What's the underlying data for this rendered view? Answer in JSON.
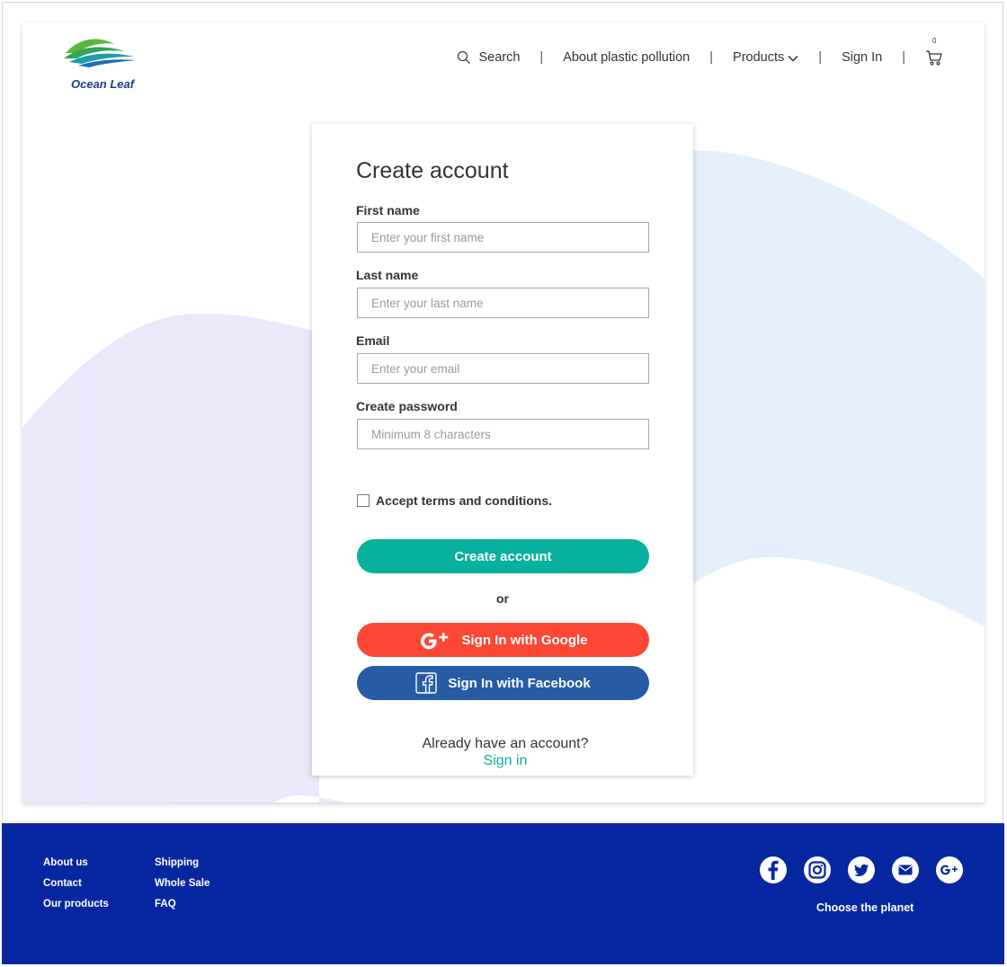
{
  "brand": {
    "name": "Ocean Leaf"
  },
  "nav": {
    "search_label": "Search",
    "about_label": "About plastic pollution",
    "products_label": "Products",
    "signin_label": "Sign In",
    "separator": "|",
    "cart_count": "0"
  },
  "form": {
    "title": "Create account",
    "first_name": {
      "label": "First name",
      "placeholder": "Enter your first name"
    },
    "last_name": {
      "label": "Last name",
      "placeholder": "Enter your last name"
    },
    "email": {
      "label": "Email",
      "placeholder": "Enter your email"
    },
    "password": {
      "label": "Create password",
      "placeholder": "Minimum 8 characters"
    },
    "terms_label": "Accept terms and conditions.",
    "terms_checked": false,
    "submit_label": "Create account",
    "or_label": "or",
    "google_label": "Sign In with Google",
    "facebook_label": "Sign In with Facebook",
    "already_text": "Already have an account?",
    "signin_link": "Sign in"
  },
  "footer": {
    "col1": [
      "About us",
      "Contact",
      "Our products"
    ],
    "col2": [
      "Shipping",
      "Whole Sale",
      "FAQ"
    ],
    "socials": [
      "facebook-icon",
      "instagram-icon",
      "twitter-icon",
      "email-icon",
      "google-plus-icon"
    ],
    "tagline": "Choose the planet"
  },
  "colors": {
    "accent_teal": "#08b19d",
    "google_red": "#fc4734",
    "facebook_blue": "#275ba4",
    "footer_blue": "#0727a1"
  }
}
